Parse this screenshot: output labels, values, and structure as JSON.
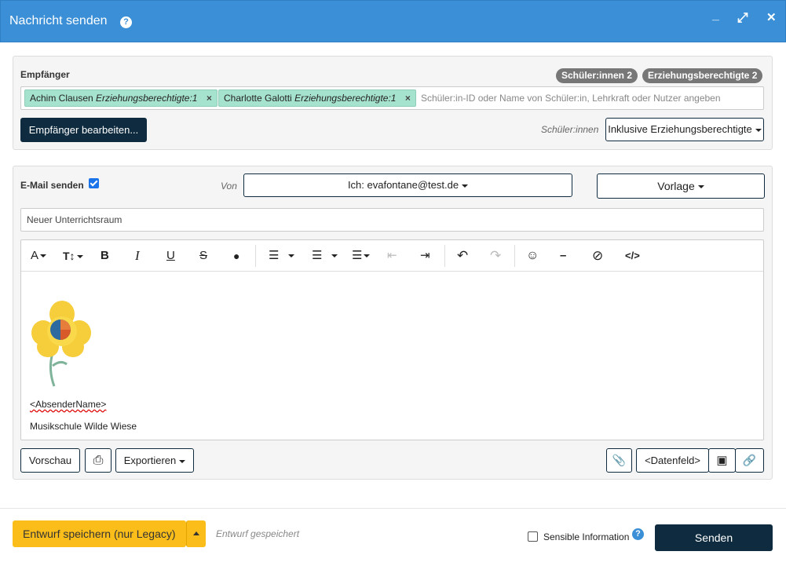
{
  "window": {
    "title": "Nachricht senden",
    "help": "?",
    "minimize": "_",
    "maximize": "⤢",
    "close": "✕"
  },
  "recipients": {
    "label": "Empfänger",
    "badge_students": "Schüler:innen 2",
    "badge_guardians": "Erziehungsberechtigte 2",
    "tags": [
      {
        "name": "Achim Clausen",
        "role": "Erziehungsberechtigte:1"
      },
      {
        "name": "Charlotte Galotti",
        "role": "Erziehungsberechtigte:1"
      }
    ],
    "tag_remove": "×",
    "placeholder": "Schüler:in-ID oder Name von Schüler:in, Lehrkraft oder Nutzer angeben",
    "edit_button": "Empfänger bearbeiten...",
    "filter_label": "Schüler:innen",
    "filter_value": "Inklusive Erziehungsberechtigte"
  },
  "email": {
    "label": "E-Mail senden",
    "checked": true,
    "from_label": "Von",
    "from_value": "Ich: evafontane@test.de",
    "template_button": "Vorlage",
    "subject": "Neuer Unterrichtsraum"
  },
  "editor": {
    "toolbar": {
      "font": "A",
      "text_size": "T↕",
      "bold": "B",
      "italic": "I",
      "underline": "U",
      "strike": "S",
      "color": "●",
      "bullets": "☰",
      "numbers": "☰",
      "align": "☰",
      "outdent": "⇤",
      "indent": "⇥",
      "undo": "↶",
      "redo": "↷",
      "emoji": "☺",
      "hr": "–",
      "clear": "⊘",
      "code": "</>"
    },
    "signature_name": "<AbsenderName>",
    "signature_school": "Musikschule Wilde Wiese"
  },
  "actions": {
    "preview": "Vorschau",
    "print": "⎙",
    "export": "Exportieren",
    "attach": "📎",
    "datafield": "<Datenfeld>",
    "image": "▣",
    "link": "🔗"
  },
  "footer": {
    "save_draft": "Entwurf speichern (nur Legacy)",
    "draft_status": "Entwurf gespeichert",
    "sensitive_label": "Sensible Information",
    "send": "Senden"
  },
  "colors": {
    "titlebar": "#3a8fd6",
    "primary_dark": "#0e2b3f",
    "tag_green": "#a6e3cf",
    "yellow": "#fbbd19"
  }
}
